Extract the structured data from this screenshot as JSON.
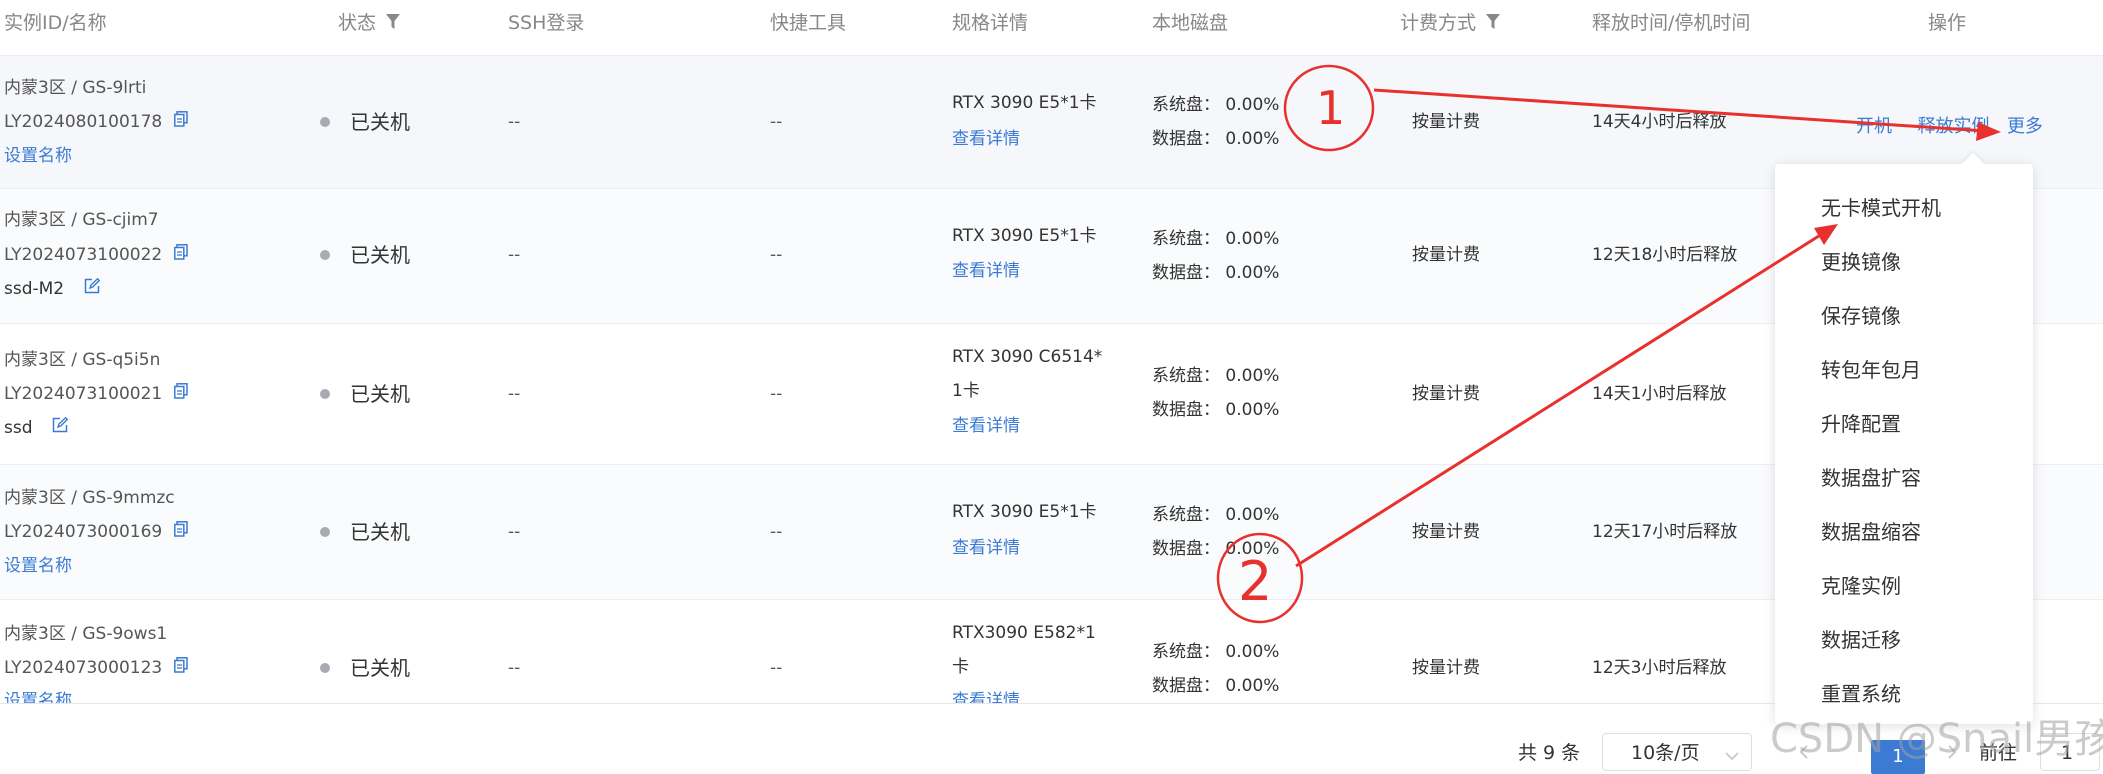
{
  "headers": {
    "instance": "实例ID/名称",
    "status": "状态",
    "ssh": "SSH登录",
    "tools": "快捷工具",
    "spec": "规格详情",
    "disk": "本地磁盘",
    "billing": "计费方式",
    "release": "释放时间/停机时间",
    "ops": "操作"
  },
  "rows": [
    {
      "zone": "内蒙3区 / GS-9lrti",
      "id": "LY2024080100178",
      "name": "设置名称",
      "name_is_link": true,
      "status": "已关机",
      "ssh": "--",
      "tools": "--",
      "spec": "RTX 3090 E5*1卡",
      "spec2": "",
      "detail": "查看详情",
      "sys_label": "系统盘：",
      "sys": "0.00%",
      "data_label": "数据盘：",
      "data": "0.00%",
      "billing": "按量计费",
      "release": "14天4小时后释放"
    },
    {
      "zone": "内蒙3区 / GS-cjim7",
      "id": "LY2024073100022",
      "name": "ssd-M2",
      "name_is_link": false,
      "status": "已关机",
      "ssh": "--",
      "tools": "--",
      "spec": "RTX 3090 E5*1卡",
      "spec2": "",
      "detail": "查看详情",
      "sys_label": "系统盘：",
      "sys": "0.00%",
      "data_label": "数据盘：",
      "data": "0.00%",
      "billing": "按量计费",
      "release": "12天18小时后释放"
    },
    {
      "zone": "内蒙3区 / GS-q5i5n",
      "id": "LY2024073100021",
      "name": "ssd",
      "name_is_link": false,
      "status": "已关机",
      "ssh": "--",
      "tools": "--",
      "spec": "RTX 3090 C6514*",
      "spec2": "1卡",
      "detail": "查看详情",
      "sys_label": "系统盘：",
      "sys": "0.00%",
      "data_label": "数据盘：",
      "data": "0.00%",
      "billing": "按量计费",
      "release": "14天1小时后释放"
    },
    {
      "zone": "内蒙3区 / GS-9mmzc",
      "id": "LY2024073000169",
      "name": "设置名称",
      "name_is_link": true,
      "status": "已关机",
      "ssh": "--",
      "tools": "--",
      "spec": "RTX 3090 E5*1卡",
      "spec2": "",
      "detail": "查看详情",
      "sys_label": "系统盘：",
      "sys": "0.00%",
      "data_label": "数据盘：",
      "data": "0.00%",
      "billing": "按量计费",
      "release": "12天17小时后释放"
    },
    {
      "zone": "内蒙3区 / GS-9ows1",
      "id": "LY2024073000123",
      "name": "设置名称",
      "name_is_link": true,
      "status": "已关机",
      "ssh": "--",
      "tools": "--",
      "spec": "RTX3090 E582*1",
      "spec2": "卡",
      "detail": "查看详情",
      "sys_label": "系统盘：",
      "sys": "0.00%",
      "data_label": "数据盘：",
      "data": "0.00%",
      "billing": "按量计费",
      "release": "12天3小时后释放"
    }
  ],
  "ops": {
    "start": "开机",
    "release": "释放实例",
    "more": "更多"
  },
  "dropdown": [
    "无卡模式开机",
    "更换镜像",
    "保存镜像",
    "转包年包月",
    "升降配置",
    "数据盘扩容",
    "数据盘缩容",
    "克隆实例",
    "数据迁移",
    "重置系统"
  ],
  "pagination": {
    "total": "共 9 条",
    "page_size": "10条/页",
    "current": "1",
    "goto": "前往",
    "goto_value": "1"
  },
  "watermark": "CSDN @Snail男孩",
  "annotations": {
    "mark1": "1",
    "mark2": "2",
    "color": "#e8312f"
  },
  "colors": {
    "link": "#3b7bd4",
    "status_dot": "#a8abb2",
    "header_text": "#888888"
  },
  "icons": {
    "filter": "filter-icon",
    "copy": "copy-icon",
    "edit": "edit-icon",
    "chevron": "chevron-down-icon"
  }
}
